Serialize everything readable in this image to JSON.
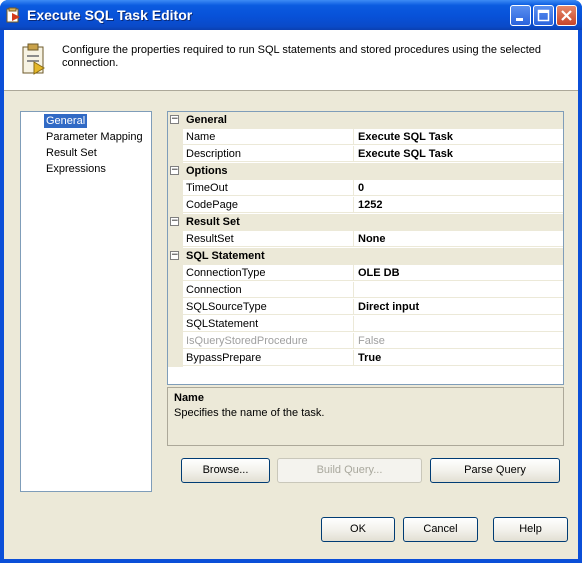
{
  "window": {
    "title": "Execute SQL Task Editor",
    "icon": "execute-sql-task-icon"
  },
  "banner": {
    "text": "Configure the properties required to run SQL statements and stored procedures using the selected connection.",
    "icon": "task-configuration-icon"
  },
  "nav": {
    "items": [
      {
        "label": "General",
        "selected": true
      },
      {
        "label": "Parameter Mapping",
        "selected": false
      },
      {
        "label": "Result Set",
        "selected": false
      },
      {
        "label": "Expressions",
        "selected": false
      }
    ]
  },
  "properties": {
    "categories": [
      {
        "label": "General",
        "toggle": "⊟",
        "props": [
          {
            "name": "Name",
            "value": "Execute SQL Task"
          },
          {
            "name": "Description",
            "value": "Execute SQL Task"
          }
        ]
      },
      {
        "label": "Options",
        "toggle": "⊟",
        "props": [
          {
            "name": "TimeOut",
            "value": "0"
          },
          {
            "name": "CodePage",
            "value": "1252"
          }
        ]
      },
      {
        "label": "Result Set",
        "toggle": "⊟",
        "props": [
          {
            "name": "ResultSet",
            "value": "None"
          }
        ]
      },
      {
        "label": "SQL Statement",
        "toggle": "⊟",
        "props": [
          {
            "name": "ConnectionType",
            "value": "OLE DB"
          },
          {
            "name": "Connection",
            "value": ""
          },
          {
            "name": "SQLSourceType",
            "value": "Direct input"
          },
          {
            "name": "SQLStatement",
            "value": ""
          },
          {
            "name": "IsQueryStoredProcedure",
            "value": "False",
            "disabled": true
          },
          {
            "name": "BypassPrepare",
            "value": "True"
          }
        ]
      }
    ]
  },
  "description": {
    "title": "Name",
    "text": "Specifies the name of the task."
  },
  "actions": {
    "browse": "Browse...",
    "build_query": "Build Query...",
    "parse_query": "Parse Query"
  },
  "footer": {
    "ok": "OK",
    "cancel": "Cancel",
    "help": "Help"
  }
}
